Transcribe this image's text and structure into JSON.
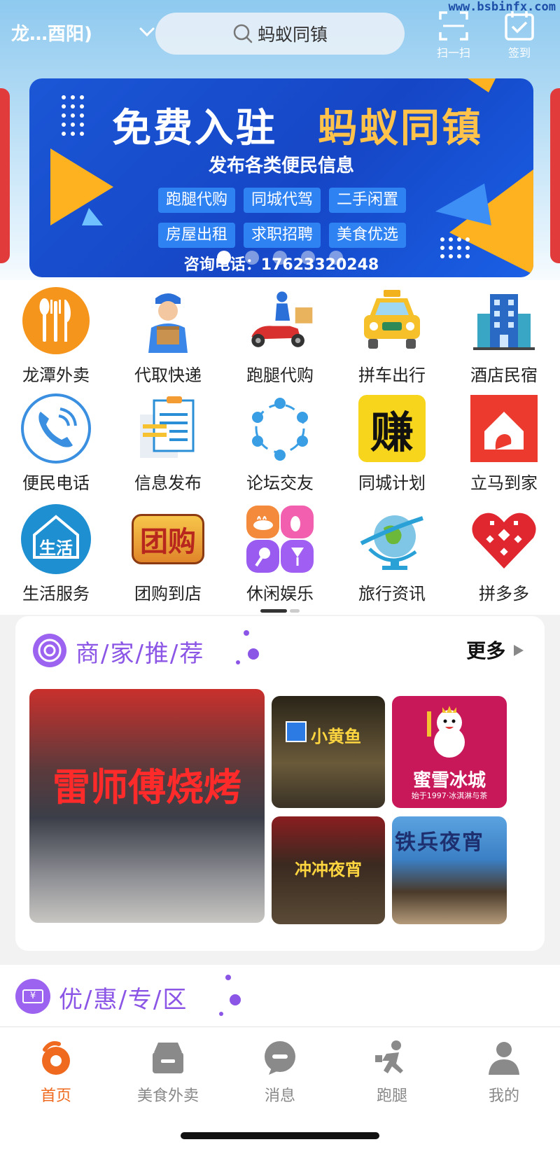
{
  "watermark": "www.bsbinfx.com",
  "header": {
    "location": "龙…酉阳)",
    "search_text": "蚂蚁同镇",
    "scan_label": "扫一扫",
    "checkin_label": "签到"
  },
  "banner": {
    "title_white": "免费入驻",
    "title_orange": "蚂蚁同镇",
    "subtitle": "发布各类便民信息",
    "tags": [
      "跑腿代购",
      "同城代驾",
      "二手闲置",
      "房屋出租",
      "求职招聘",
      "美食优选"
    ],
    "phone": "咨询电话：17623320248",
    "page_count": 5,
    "active_page": 1
  },
  "services": [
    {
      "label": "龙潭外卖",
      "icon": "fork-knife-icon"
    },
    {
      "label": "代取快递",
      "icon": "courier-icon"
    },
    {
      "label": "跑腿代购",
      "icon": "scooter-icon"
    },
    {
      "label": "拼车出行",
      "icon": "taxi-icon"
    },
    {
      "label": "酒店民宿",
      "icon": "hotel-icon"
    },
    {
      "label": "便民电话",
      "icon": "phone-icon"
    },
    {
      "label": "信息发布",
      "icon": "clipboard-icon"
    },
    {
      "label": "论坛交友",
      "icon": "network-icon"
    },
    {
      "label": "同城计划",
      "icon": "earn-icon"
    },
    {
      "label": "立马到家",
      "icon": "house-icon"
    },
    {
      "label": "生活服务",
      "icon": "life-icon"
    },
    {
      "label": "团购到店",
      "icon": "group-buy-icon"
    },
    {
      "label": "休闲娱乐",
      "icon": "leisure-icon"
    },
    {
      "label": "旅行资讯",
      "icon": "globe-icon"
    },
    {
      "label": "拼多多",
      "icon": "pinduoduo-icon"
    }
  ],
  "services_earn_char": "赚",
  "services_life_text": "生活",
  "services_group_text": "团购",
  "merchant": {
    "title": "商/家/推/荐",
    "more": "更多",
    "photos": [
      {
        "name": "雷师傅烧烤"
      },
      {
        "name": "小黄鱼"
      },
      {
        "name": "蜜雪冰城",
        "sub": "始于1997·冰淇淋与茶"
      },
      {
        "name": "冲冲夜宵"
      },
      {
        "name": "铁兵夜宵"
      }
    ]
  },
  "promo": {
    "title": "优/惠/专/区",
    "coupon_symbol": "¥"
  },
  "tabs": [
    {
      "label": "首页",
      "icon": "home-icon",
      "active": true
    },
    {
      "label": "美食外卖",
      "icon": "food-box-icon",
      "active": false
    },
    {
      "label": "消息",
      "icon": "message-icon",
      "active": false
    },
    {
      "label": "跑腿",
      "icon": "runner-icon",
      "active": false
    },
    {
      "label": "我的",
      "icon": "profile-icon",
      "active": false
    }
  ],
  "colors": {
    "accent": "#ef6a1e",
    "purple": "#8b55e6",
    "banner_blue": "#1546c6"
  }
}
